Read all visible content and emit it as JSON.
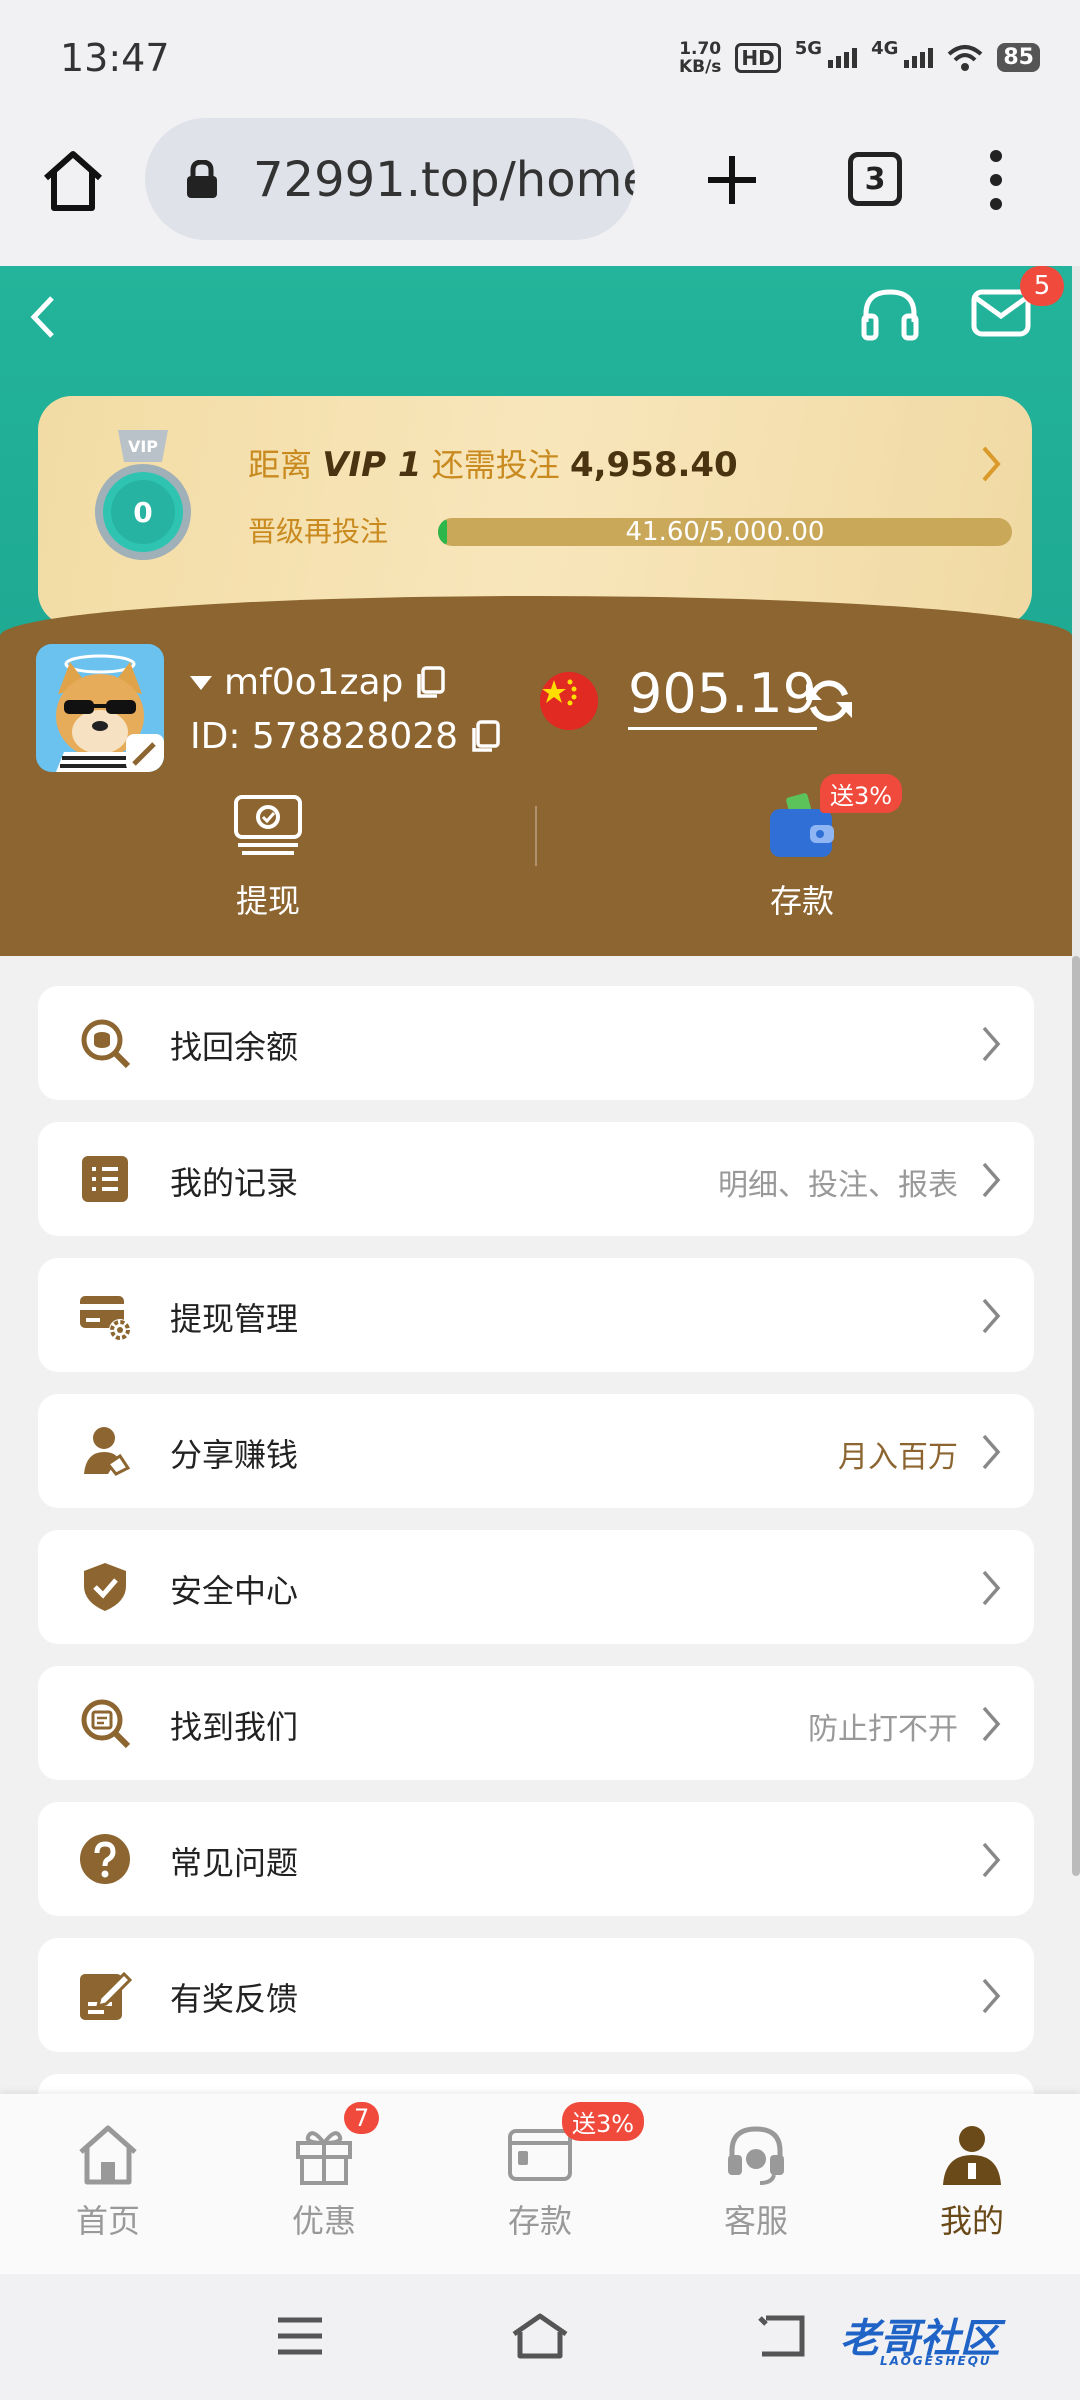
{
  "status": {
    "time": "13:47",
    "net_speed": "1.70",
    "net_unit": "KB/s",
    "hd_label": "HD",
    "sim1": "5G",
    "sim2": "4G",
    "battery": "85"
  },
  "browser": {
    "url": "72991.top/home",
    "tab_count": "3"
  },
  "header": {
    "mail_badge": "5",
    "vip": {
      "level_prefix": "距离",
      "level_name": "VIP 1",
      "need_text": "还需投注",
      "need_amount": "4,958.40",
      "sub_label": "晋级再投注",
      "progress_text": "41.60/5,000.00",
      "progress_value": 0.0083,
      "medal_level": "0",
      "medal_tag": "VIP"
    },
    "user": {
      "name": "mf0o1zap",
      "id": "ID: 578828028",
      "balance": "905.19"
    },
    "actions": {
      "withdraw": "提现",
      "deposit": "存款",
      "deposit_promo": "送3%"
    }
  },
  "menu": [
    {
      "label": "找回余额",
      "extra": "",
      "icon": "search-coin-icon"
    },
    {
      "label": "我的记录",
      "extra": "明细、投注、报表",
      "icon": "list-icon"
    },
    {
      "label": "提现管理",
      "extra": "",
      "icon": "card-gear-icon"
    },
    {
      "label": "分享赚钱",
      "extra": "月入百万",
      "icon": "share-user-icon"
    },
    {
      "label": "安全中心",
      "extra": "",
      "icon": "shield-check-icon"
    },
    {
      "label": "找到我们",
      "extra": "防止打不开",
      "icon": "search-web-icon"
    },
    {
      "label": "常见问题",
      "extra": "",
      "icon": "question-icon"
    },
    {
      "label": "有奖反馈",
      "extra": "",
      "icon": "feedback-edit-icon"
    }
  ],
  "bottom_nav": [
    {
      "label": "首页",
      "badge": ""
    },
    {
      "label": "优惠",
      "badge": "7"
    },
    {
      "label": "存款",
      "badge": "送3%"
    },
    {
      "label": "客服",
      "badge": ""
    },
    {
      "label": "我的",
      "badge": ""
    }
  ],
  "watermark": {
    "main": "老哥社区",
    "sub": "LAOGESHEQU"
  },
  "colors": {
    "teal": "#1aa08c",
    "brown": "#8c6530",
    "gold_text": "#c98a20",
    "badge_red": "#f04a3c",
    "progress_green": "#2db64a"
  }
}
